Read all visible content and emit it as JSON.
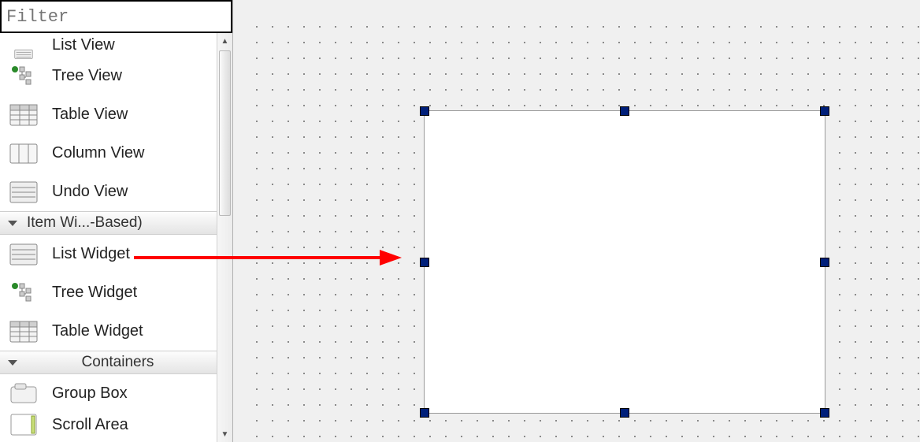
{
  "filter": {
    "placeholder": "Filter"
  },
  "model_views": {
    "items": [
      {
        "label": "List View"
      },
      {
        "label": "Tree View"
      },
      {
        "label": "Table View"
      },
      {
        "label": "Column View"
      },
      {
        "label": "Undo View"
      }
    ]
  },
  "item_widgets": {
    "header": "Item Wi...-Based)",
    "items": [
      {
        "label": "List Widget"
      },
      {
        "label": "Tree Widget"
      },
      {
        "label": "Table Widget"
      }
    ]
  },
  "containers": {
    "header": "Containers",
    "items": [
      {
        "label": "Group Box"
      },
      {
        "label": "Scroll Area"
      }
    ]
  }
}
